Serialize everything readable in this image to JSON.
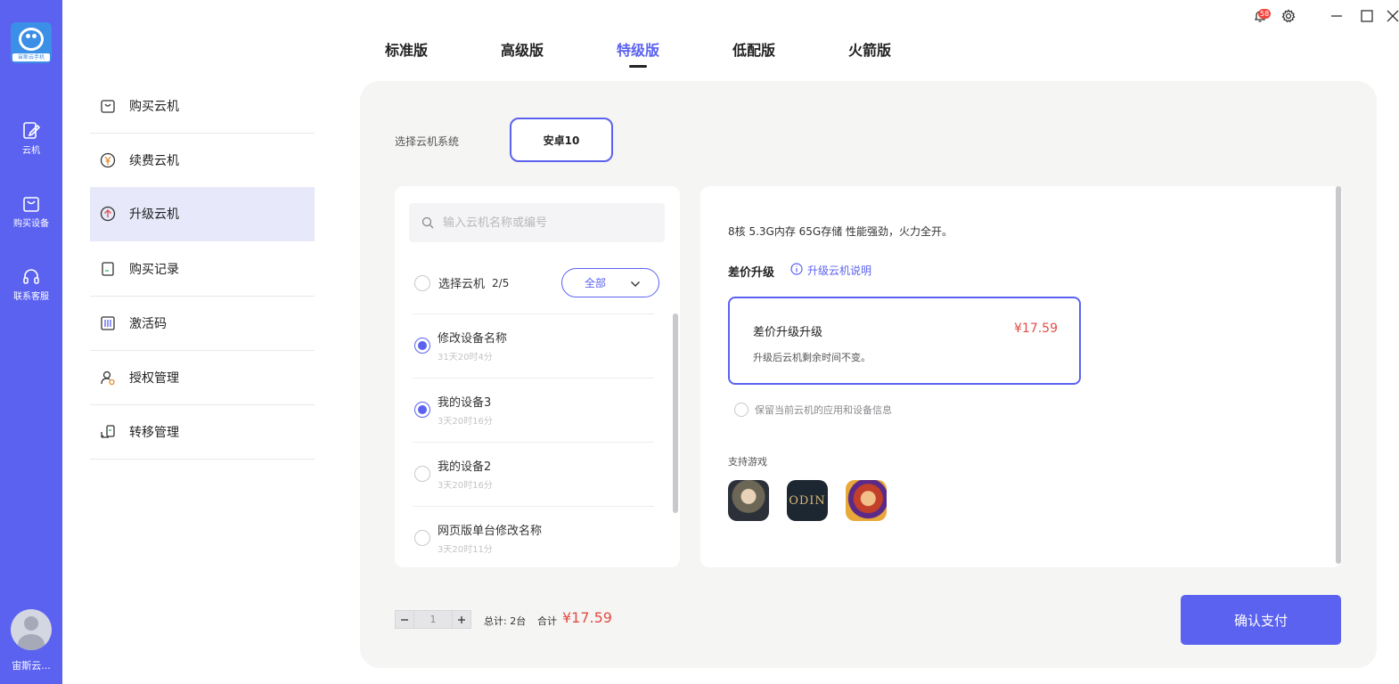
{
  "app": {
    "logo_text": "宙斯云手机",
    "user_name": "宙斯云..."
  },
  "rail": {
    "items": [
      {
        "label": "云机",
        "icon": "cloud-phone-icon"
      },
      {
        "label": "购买设备",
        "icon": "shopping-bag-icon"
      },
      {
        "label": "联系客服",
        "icon": "headset-icon"
      }
    ]
  },
  "menu": {
    "items": [
      {
        "label": "购买云机",
        "icon": "shopping-bag-icon"
      },
      {
        "label": "续费云机",
        "icon": "yen-coin-icon"
      },
      {
        "label": "升级云机",
        "icon": "upgrade-arrow-icon",
        "active": true
      },
      {
        "label": "购买记录",
        "icon": "receipt-icon"
      },
      {
        "label": "激活码",
        "icon": "barcode-icon"
      },
      {
        "label": "授权管理",
        "icon": "user-lock-icon"
      },
      {
        "label": "转移管理",
        "icon": "transfer-icon"
      }
    ]
  },
  "tabs": [
    {
      "label": "标准版"
    },
    {
      "label": "高级版"
    },
    {
      "label": "特级版",
      "active": true
    },
    {
      "label": "低配版"
    },
    {
      "label": "火箭版"
    }
  ],
  "notifications": {
    "count": "58"
  },
  "os": {
    "label": "选择云机系统",
    "selected": "安卓10"
  },
  "device_list": {
    "search_placeholder": "输入云机名称或编号",
    "select_label": "选择云机",
    "select_count": "2/5",
    "filter": "全部",
    "devices": [
      {
        "name": "修改设备名称",
        "time": "31天20时4分",
        "selected": true
      },
      {
        "name": "我的设备3",
        "time": "3天20时16分",
        "selected": true
      },
      {
        "name": "我的设备2",
        "time": "3天20时16分",
        "selected": false
      },
      {
        "name": "网页版单台修改名称",
        "time": "3天20时11分",
        "selected": false
      }
    ]
  },
  "detail": {
    "spec": "8核 5.3G内存 65G存储 性能强劲，火力全开。",
    "section_title": "差价升级",
    "explain_link": "升级云机说明",
    "option": {
      "title": "差价升级升级",
      "price": "¥17.59",
      "desc": "升级后云机剩余时间不变。"
    },
    "keep_data": "保留当前云机的应用和设备信息",
    "games_label": "支持游戏",
    "games": [
      {
        "icon": "soldier-game-icon"
      },
      {
        "icon": "odin-game-icon",
        "label": "ODIN"
      },
      {
        "icon": "hero-game-icon"
      }
    ]
  },
  "footer": {
    "quantity": "1",
    "total_count": "总计: 2台",
    "sum_label": "合计",
    "sum_value": "¥17.59",
    "pay_label": "确认支付"
  },
  "colors": {
    "accent": "#5b62f0",
    "price": "#e24c43",
    "panel_bg": "#f5f5f4"
  }
}
